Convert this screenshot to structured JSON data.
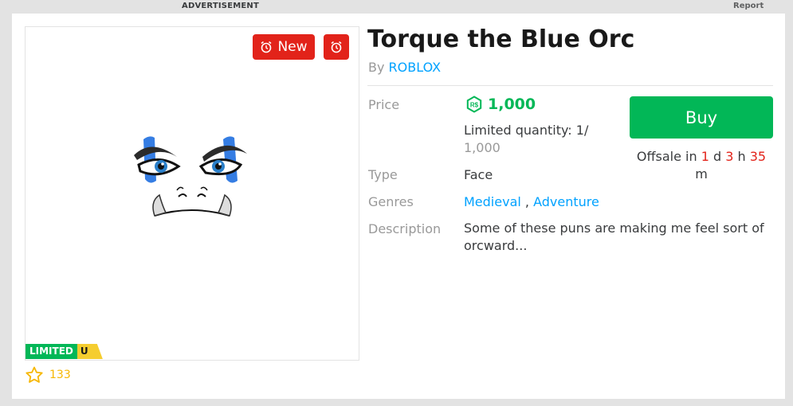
{
  "top_bar": {
    "ad_label": "ADVERTISEMENT",
    "report_label": "Report"
  },
  "item": {
    "title": "Torque the Blue Orc",
    "by_prefix": "By",
    "creator": "ROBLOX",
    "badge_new": "New",
    "limited_label": "LIMITED",
    "limited_u": "U",
    "favorites": "133"
  },
  "details": {
    "price_label": "Price",
    "price_value": "1,000",
    "currency_icon": "robux-icon",
    "limited_qty_prefix": "Limited quantity: 1/",
    "limited_qty_total": "1,000",
    "type_label": "Type",
    "type_value": "Face",
    "genres_label": "Genres",
    "genre_1": "Medieval",
    "genre_sep": ",",
    "genre_2": "Adventure",
    "description_label": "Description",
    "description": "Some of these puns are making me feel sort of orcward..."
  },
  "purchase": {
    "buy_label": "Buy",
    "offsale_prefix": "Offsale in",
    "days": "1",
    "days_unit": "d",
    "hours": "3",
    "hours_unit": "h",
    "minutes": "35",
    "minutes_unit": "m"
  },
  "colors": {
    "accent_blue": "#00a2ff",
    "buy_green": "#02b757",
    "alert_red": "#e2231a",
    "star_gold": "#f6b702"
  }
}
